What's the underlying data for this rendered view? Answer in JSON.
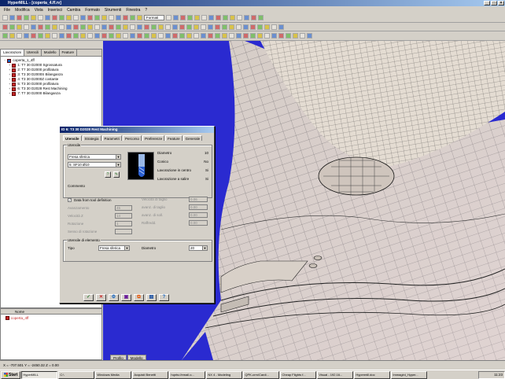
{
  "window": {
    "title": "HyperMILL - [coperta_4.ff.rv]"
  },
  "menu": [
    "File",
    "Modifica",
    "Vista",
    "Inserisci",
    "Cambia",
    "Formato",
    "Strumenti",
    "Finestra",
    "?"
  ],
  "toolbar": {
    "format_label": "Formati",
    "zoom_value": "1"
  },
  "left_panel": {
    "tabs": [
      "Lavorazioni",
      "Utensili",
      "Modello",
      "Feature"
    ],
    "active_tab": 0,
    "tree": [
      {
        "label": "coperta_1_4ff",
        "root": true
      },
      {
        "label": "1: T7 30 D2000 Sgrossatura"
      },
      {
        "label": "2: T7 30 D2000 profilatura"
      },
      {
        "label": "3: T3 30 D2000S Bilanganza"
      },
      {
        "label": "4: T3 30 D2000Z costante"
      },
      {
        "label": "5: T3 30 D2000 profilatura"
      },
      {
        "label": "6: T3 30 D2028 Rest Machining"
      },
      {
        "label": "7: T7 30 D2000 Bilanganza"
      }
    ]
  },
  "lower_panel": {
    "column": "Nome",
    "item": "coperta_4ff"
  },
  "dialog": {
    "title": "ID 6: T3 30 D2028 Rest Machining",
    "tabs": [
      "Utensile",
      "Strategia",
      "Parametri",
      "Percorso",
      "Preferenze",
      "Feature",
      "Generale"
    ],
    "active_tab": 0,
    "tool_group_label": "Utensile",
    "tool_type": "Fresa sferica",
    "tool_id": "5: SF10 Ø10",
    "specs": [
      {
        "label": "Diametro",
        "value": "10"
      },
      {
        "label": "Conico",
        "value": "No"
      },
      {
        "label": "Lavorazione in centro",
        "value": "Si"
      },
      {
        "label": "Lavorazione a salire",
        "value": "Si"
      }
    ],
    "comment_label": "Commento",
    "data_checkbox_label": "Data from tool definition",
    "left_params": [
      {
        "label": "Avanzamento",
        "value": "45"
      },
      {
        "label": "Velocità Z",
        "value": "14"
      },
      {
        "label": "Rotazione",
        "value": "1"
      },
      {
        "label": "Senso di rotazione",
        "value": ""
      }
    ],
    "right_params": [
      {
        "label": "Velocità di taglio",
        "value": "0.06"
      },
      {
        "label": "avanz. di taglio",
        "value": "0.00"
      },
      {
        "label": "avanz. di soll.",
        "value": "0.00"
      },
      {
        "label": "Raffredd.",
        "value": "0.00"
      }
    ],
    "element_group_label": "Utensile di elemento",
    "type_label": "Tipo",
    "type_value": "Fresa sferica",
    "diameter_label": "Diametro",
    "diameter_value": "20"
  },
  "statusbar": {
    "coords": "X = -707.501    Y = -2450.32    Z = 0.00"
  },
  "viewport_tabs": [
    "Profilo",
    "Modello"
  ],
  "taskbar": {
    "start": "Start",
    "tasks": [
      "HyperMILL",
      "C:\\",
      "Windows Media",
      "Acquisti Benetti",
      "hqnts://email.o...",
      "NX 4 - Modeling",
      "QPK-crm/Cardi...",
      "Cheap Flights f...",
      "Visual - 192.16...",
      "Hypermill.doc",
      "Immagini_Hyper..."
    ],
    "active": 0,
    "clock": "11:23"
  },
  "colors": {
    "viewport_bg": "#2a2ad0",
    "titlebar": "#0a246a",
    "mesh_fill": "#d6cec2",
    "mesh_line": "#3a3a3a"
  }
}
